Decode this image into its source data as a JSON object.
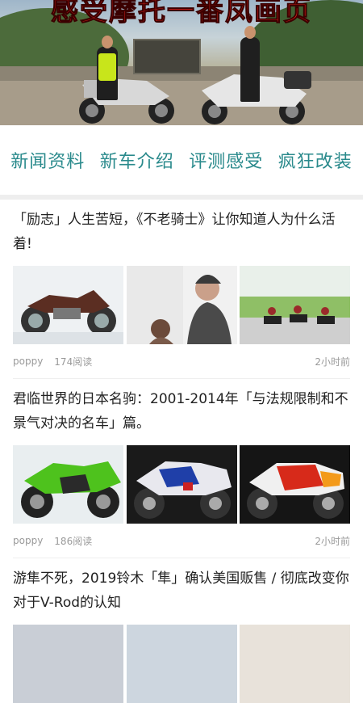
{
  "banner": {
    "title": "感受摩托一番凤画页"
  },
  "tabs": [
    {
      "label": "新闻资料"
    },
    {
      "label": "新车介绍"
    },
    {
      "label": "评测感受"
    },
    {
      "label": "疯狂改装"
    }
  ],
  "articles": [
    {
      "title": "「励志」人生苦短，《不老骑士》让你知道人为什么活着!",
      "author": "poppy",
      "reads": "174阅读",
      "time": "2小时前",
      "images": [
        "cruiser-motorcycle-image",
        "elderly-rider-image",
        "riders-group-image"
      ]
    },
    {
      "title": "君临世界的日本名驹：2001-2014年「与法规限制和不景气对决的名车」篇。",
      "author": "poppy",
      "reads": "186阅读",
      "time": "2小时前",
      "images": [
        "green-sportbike-image",
        "blue-white-sportbike-image",
        "red-racing-bike-image"
      ]
    },
    {
      "title": "游隼不死，2019铃木「隼」确认美国贩售 / 彻底改变你对于V-Rod的认知"
    }
  ],
  "colors": {
    "tab_text": "#2a8a8c",
    "meta_text": "#9a9a9a",
    "banner_title": "#e0201b"
  }
}
